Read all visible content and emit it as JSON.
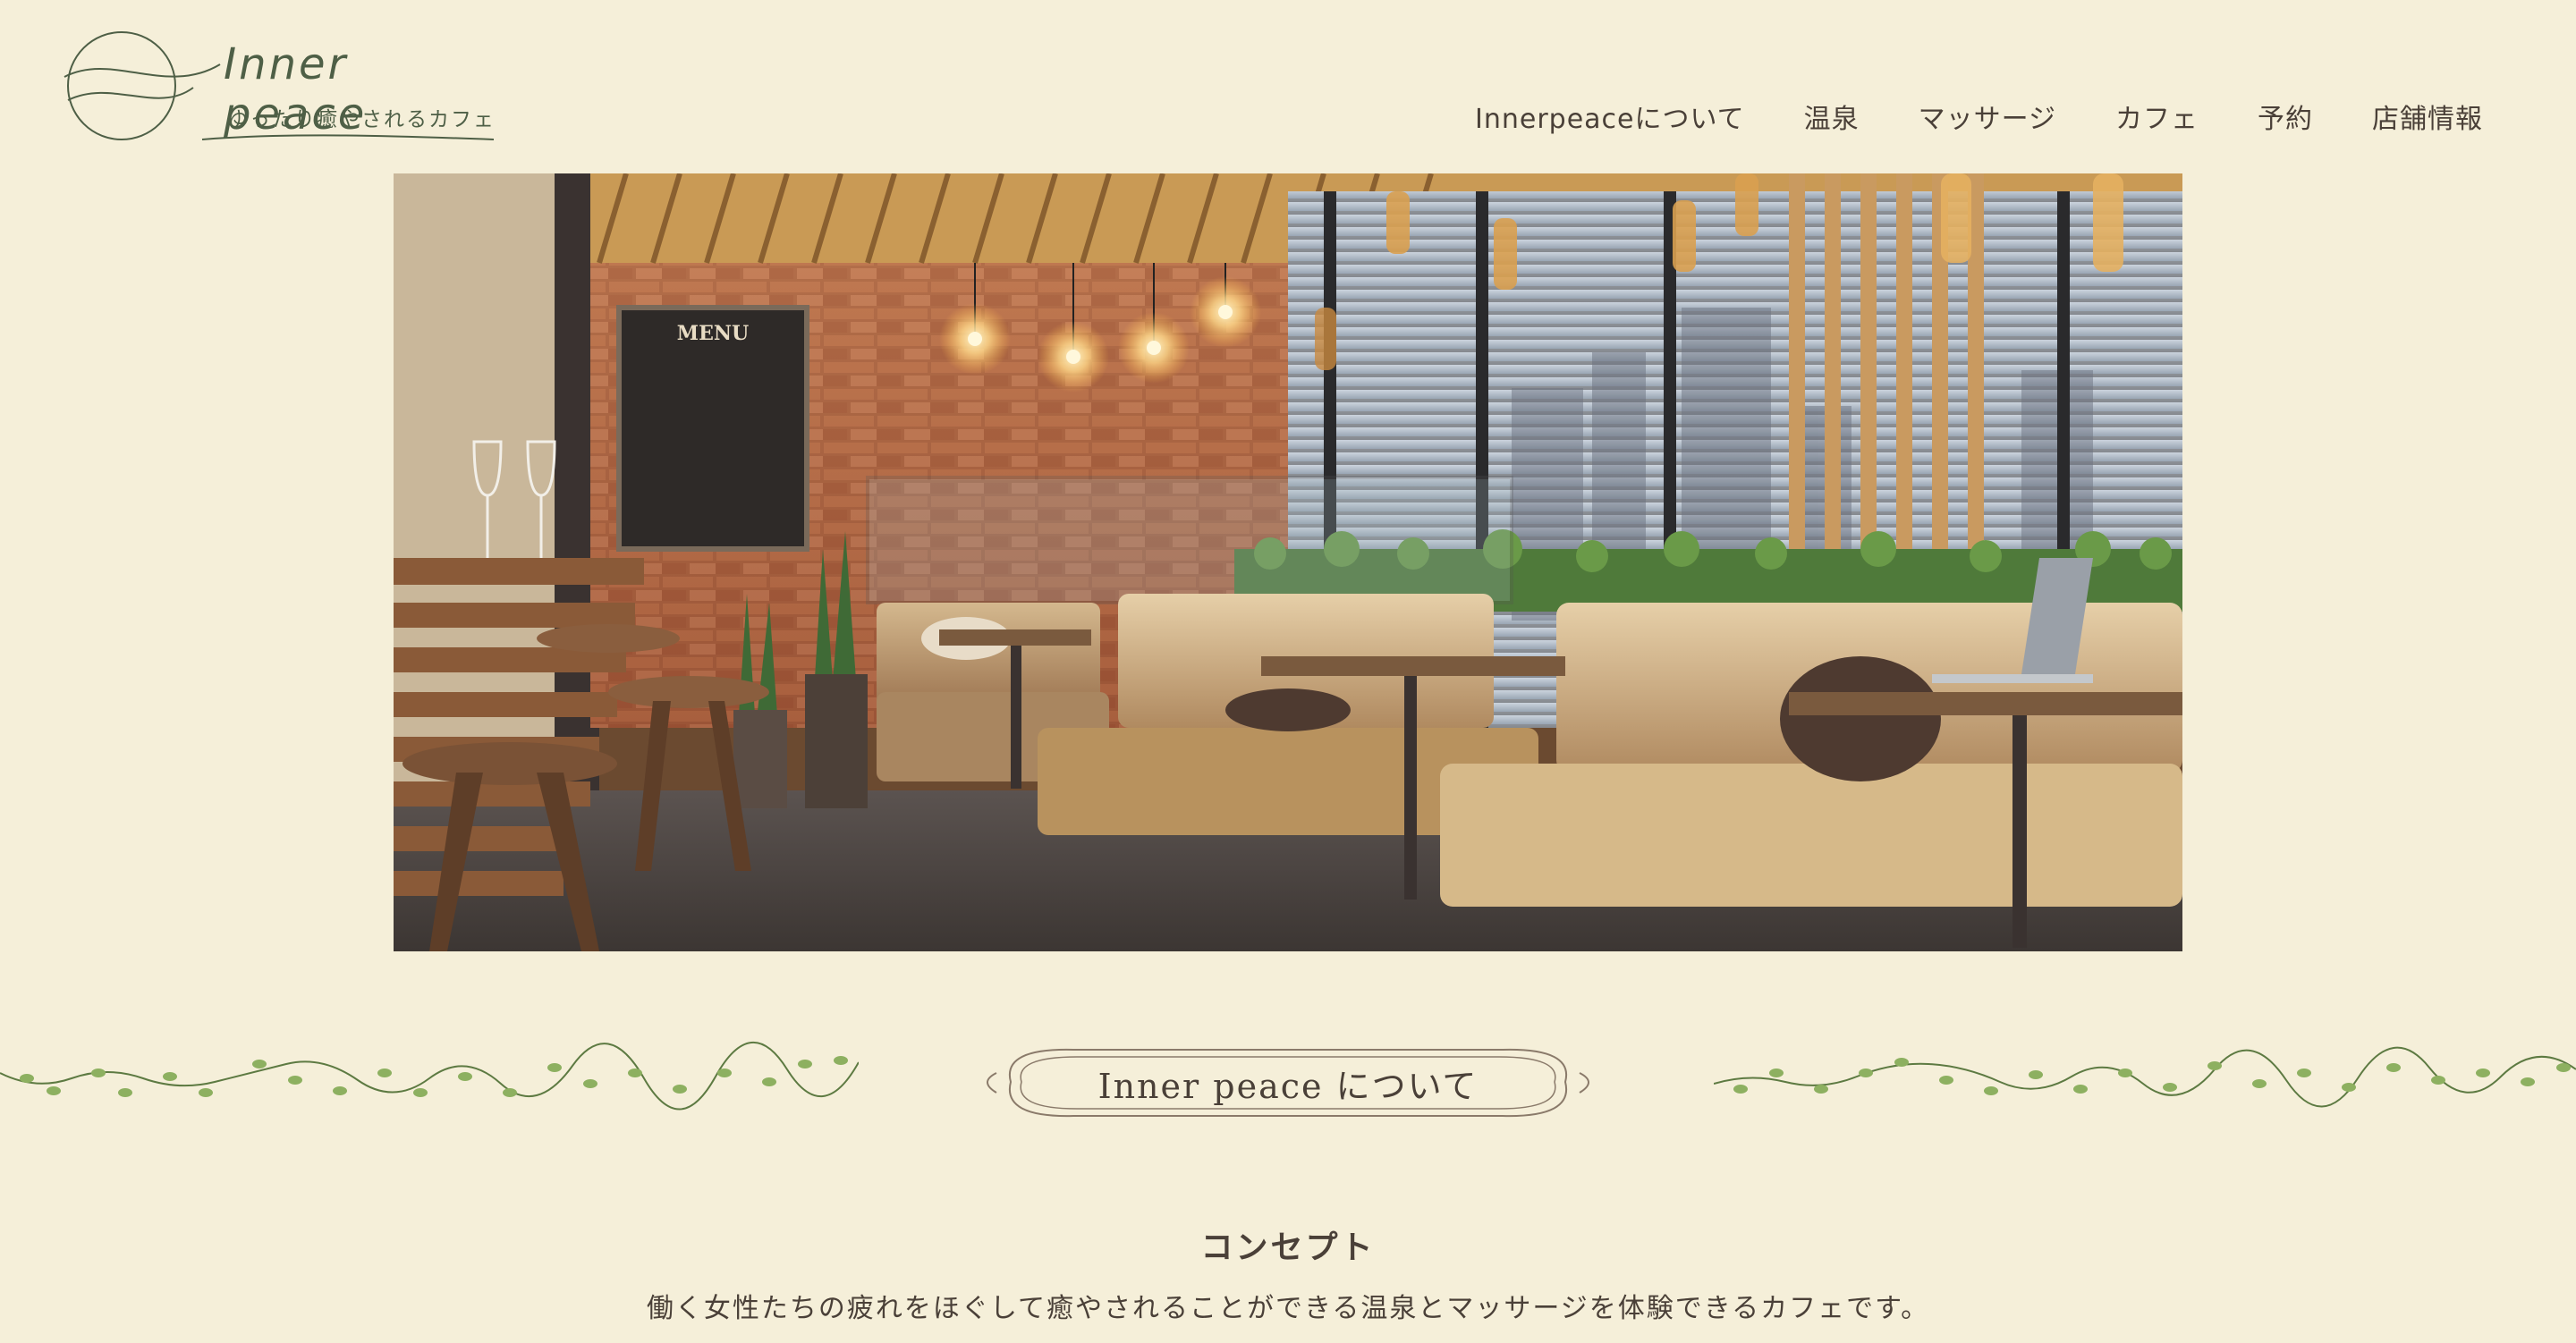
{
  "header": {
    "logo_title": "Inner peace",
    "logo_tagline": "ゆったり癒やされるカフェ"
  },
  "nav": {
    "items": [
      {
        "label": "Innerpeaceについて"
      },
      {
        "label": "温泉"
      },
      {
        "label": "マッサージ"
      },
      {
        "label": "カフェ"
      },
      {
        "label": "予約"
      },
      {
        "label": "店舗情報"
      }
    ]
  },
  "hero": {
    "menu_board_text": "MENU"
  },
  "about": {
    "section_title": "Inner peace について",
    "concept_title": "コンセプト",
    "concept_text": "働く女性たちの疲れをほぐして癒やされることができる温泉とマッサージを体験できるカフェです。"
  },
  "colors": {
    "background": "#f5efd9",
    "text": "#4a4038",
    "logo_green": "#4e5f46",
    "vine_green": "#7a9a5a"
  },
  "icons": [
    "logo-circle-icon",
    "vine-decoration-icon",
    "heading-frame-icon"
  ]
}
